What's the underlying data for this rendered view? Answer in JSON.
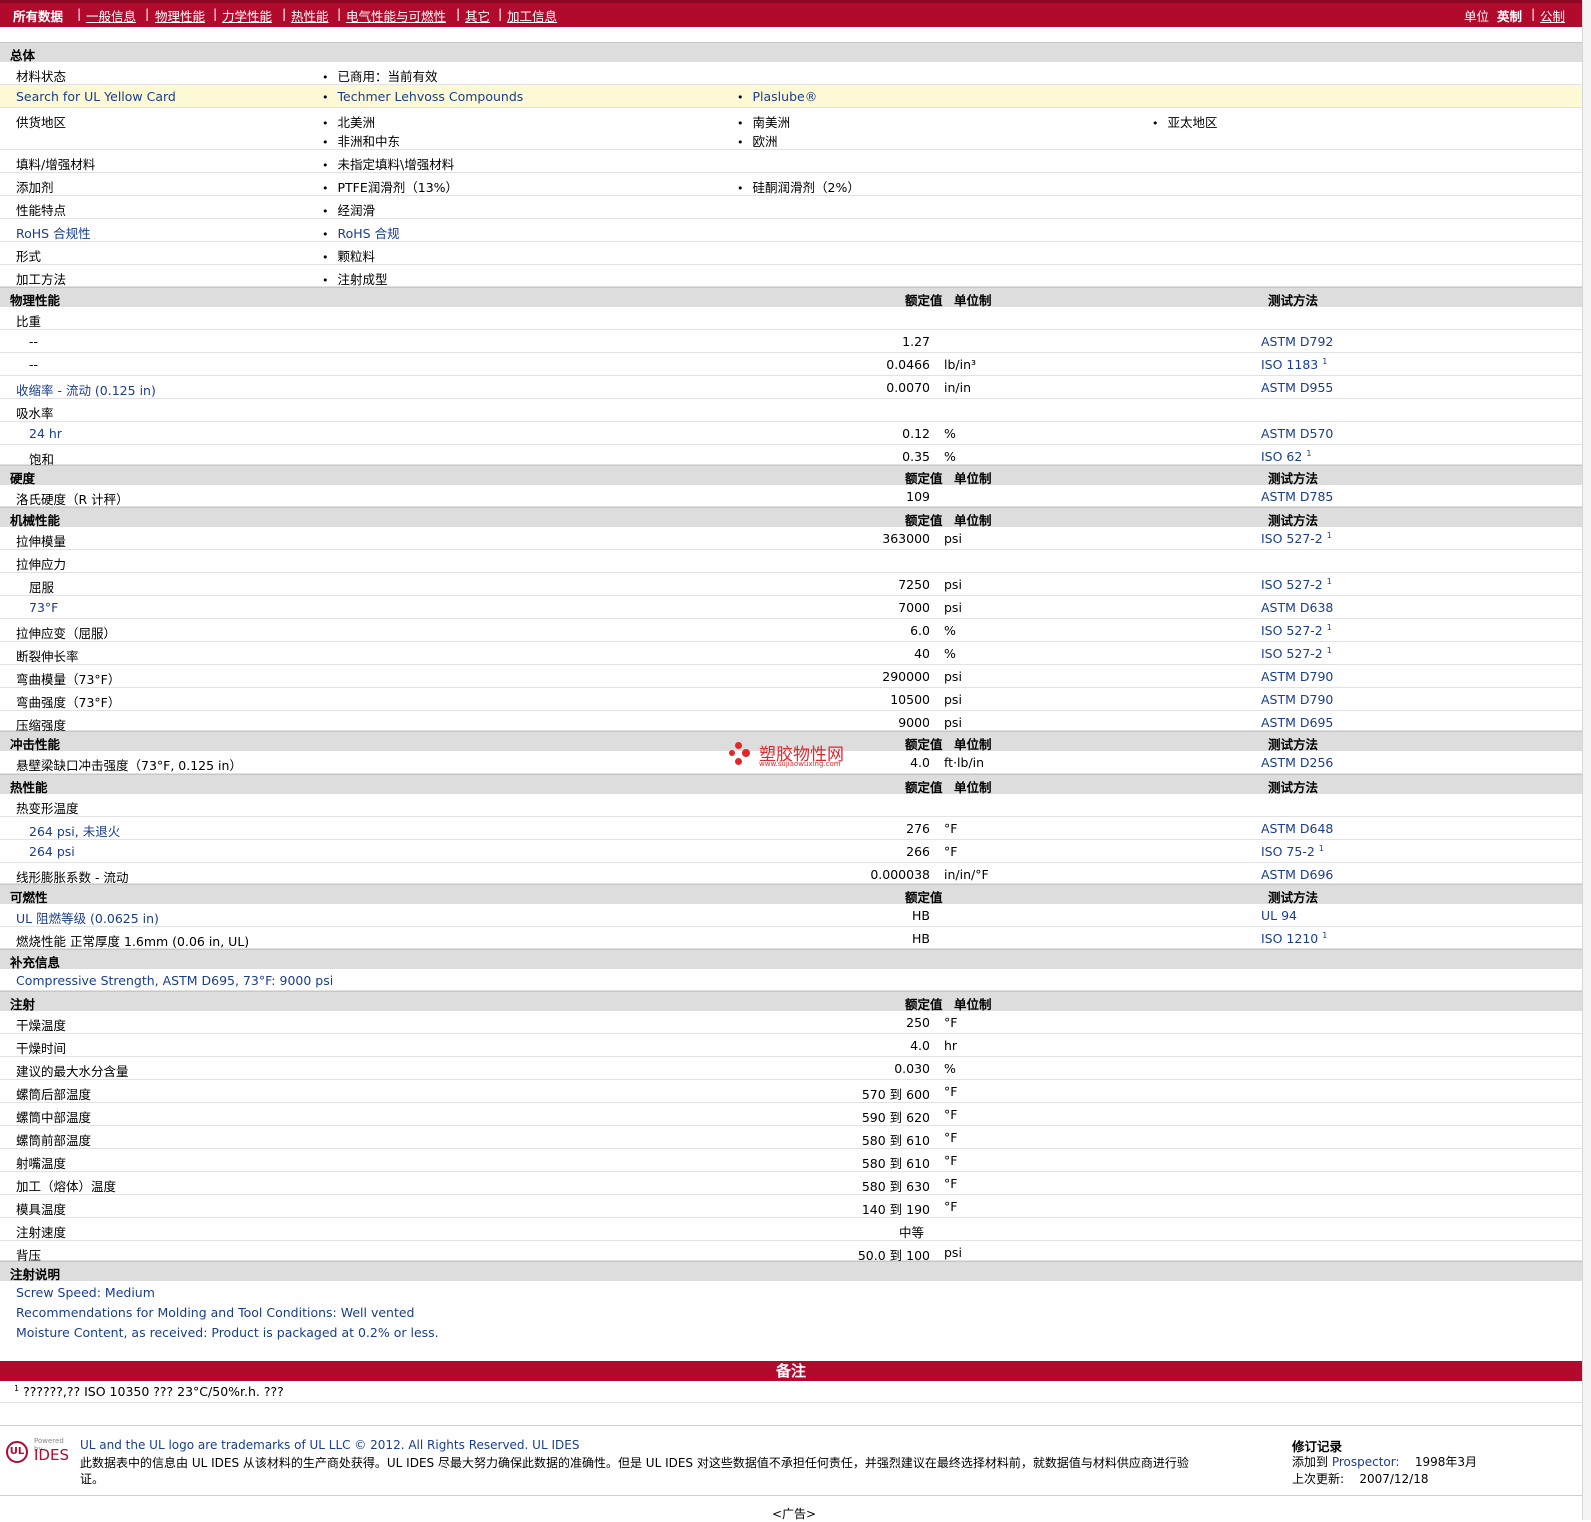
{
  "nav": {
    "all_data": "所有数据",
    "tabs": [
      "一般信息",
      "物理性能",
      "力学性能",
      "热性能",
      "电气性能与可燃性",
      "其它",
      "加工信息"
    ],
    "unit_label": "单位",
    "unit_imperial": "英制",
    "unit_metric": "公制"
  },
  "headers": {
    "nominal": "额定值",
    "unit": "单位制",
    "method": "测试方法"
  },
  "general": {
    "title": "总体",
    "rows": [
      {
        "label": "材料状态",
        "items": [
          "已商用：当前有效"
        ]
      },
      {
        "label": "Search for UL Yellow Card",
        "items": [
          "Techmer Lehvoss Compounds",
          "Plaslube®"
        ]
      },
      {
        "label": "供货地区",
        "items": [
          "北美洲",
          "南美洲",
          "亚太地区",
          "非洲和中东",
          "欧洲"
        ]
      },
      {
        "label": "填料/增强材料",
        "items": [
          "未指定填料\\增强材料"
        ]
      },
      {
        "label": "添加剂",
        "items": [
          "PTFE润滑剂（13%）",
          "硅酮润滑剂（2%）"
        ]
      },
      {
        "label": "性能特点",
        "items": [
          "经润滑"
        ]
      },
      {
        "label": "RoHS 合规性",
        "items": [
          "RoHS 合规"
        ]
      },
      {
        "label": "形式",
        "items": [
          "颗粒料"
        ]
      },
      {
        "label": "加工方法",
        "items": [
          "注射成型"
        ]
      }
    ]
  },
  "physical": {
    "title": "物理性能",
    "rows": [
      {
        "label": "比重",
        "value": "",
        "unit": "",
        "method": ""
      },
      {
        "label": "--",
        "value": "1.27",
        "unit": "",
        "method": "ASTM D792"
      },
      {
        "label": "--",
        "value": "0.0466",
        "unit": "lb/in³",
        "method": "ISO 1183"
      },
      {
        "label": "收缩率 - 流动 (0.125 in)",
        "value": "0.0070",
        "unit": "in/in",
        "method": "ASTM D955"
      },
      {
        "label": "吸水率",
        "value": "",
        "unit": "",
        "method": ""
      },
      {
        "label": "24 hr",
        "value": "0.12",
        "unit": "%",
        "method": "ASTM D570"
      },
      {
        "label": "饱和",
        "value": "0.35",
        "unit": "%",
        "method": "ISO 62"
      }
    ]
  },
  "hardness": {
    "title": "硬度",
    "rows": [
      {
        "label": "洛氏硬度（R 计秤）",
        "value": "109",
        "unit": "",
        "method": "ASTM D785"
      }
    ]
  },
  "mechanical": {
    "title": "机械性能",
    "rows": [
      {
        "label": "拉伸模量",
        "value": "363000",
        "unit": "psi",
        "method": "ISO 527-2"
      },
      {
        "label": "拉伸应力",
        "value": "",
        "unit": "",
        "method": ""
      },
      {
        "label": "屈服",
        "value": "7250",
        "unit": "psi",
        "method": "ISO 527-2"
      },
      {
        "label": "73°F",
        "value": "7000",
        "unit": "psi",
        "method": "ASTM D638"
      },
      {
        "label": "拉伸应变（屈服）",
        "value": "6.0",
        "unit": "%",
        "method": "ISO 527-2"
      },
      {
        "label": "断裂伸长率",
        "value": "40",
        "unit": "%",
        "method": "ISO 527-2"
      },
      {
        "label": "弯曲模量（73°F）",
        "value": "290000",
        "unit": "psi",
        "method": "ASTM D790"
      },
      {
        "label": "弯曲强度（73°F）",
        "value": "10500",
        "unit": "psi",
        "method": "ASTM D790"
      },
      {
        "label": "压缩强度",
        "value": "9000",
        "unit": "psi",
        "method": "ASTM D695"
      }
    ]
  },
  "impact": {
    "title": "冲击性能",
    "rows": [
      {
        "label": "悬壁梁缺口冲击强度（73°F, 0.125 in）",
        "value": "4.0",
        "unit": "ft·lb/in",
        "method": "ASTM D256"
      }
    ]
  },
  "thermal": {
    "title": "热性能",
    "rows": [
      {
        "label": "热变形温度",
        "value": "",
        "unit": "",
        "method": ""
      },
      {
        "label": "264 psi, 未退火",
        "value": "276",
        "unit": "°F",
        "method": "ASTM D648"
      },
      {
        "label": "264 psi",
        "value": "266",
        "unit": "°F",
        "method": "ISO 75-2"
      },
      {
        "label": "线形膨胀系数 - 流动",
        "value": "0.000038",
        "unit": "in/in/°F",
        "method": "ASTM D696"
      }
    ]
  },
  "flammability": {
    "title": "可燃性",
    "rows": [
      {
        "label": "UL 阻燃等级 (0.0625 in)",
        "value": "HB",
        "unit": "",
        "method": "UL 94"
      },
      {
        "label": "燃烧性能  正常厚度  1.6mm (0.06 in, UL)",
        "value": "HB",
        "unit": "",
        "method": "ISO 1210"
      }
    ]
  },
  "supplement": {
    "title": "补充信息",
    "text": "Compressive Strength, ASTM D695, 73°F: 9000 psi"
  },
  "injection": {
    "title": "注射",
    "rows": [
      {
        "label": "干燥温度",
        "value": "250",
        "unit": "°F"
      },
      {
        "label": "干燥时间",
        "value": "4.0",
        "unit": "hr"
      },
      {
        "label": "建议的最大水分含量",
        "value": "0.030",
        "unit": "%"
      },
      {
        "label": "螺筒后部温度",
        "value": "570 到  600",
        "unit": "°F"
      },
      {
        "label": "螺筒中部温度",
        "value": "590 到  620",
        "unit": "°F"
      },
      {
        "label": "螺筒前部温度",
        "value": "580 到  610",
        "unit": "°F"
      },
      {
        "label": "射嘴温度",
        "value": "580 到  610",
        "unit": "°F"
      },
      {
        "label": "加工（熔体）温度",
        "value": "580 到  630",
        "unit": "°F"
      },
      {
        "label": "模具温度",
        "value": "140 到  190",
        "unit": "°F"
      },
      {
        "label": "注射速度",
        "value": "中等",
        "unit": ""
      },
      {
        "label": "背压",
        "value": "50.0 到  100",
        "unit": "psi"
      }
    ]
  },
  "injection_notes": {
    "title": "注射说明",
    "lines": [
      "Screw Speed: Medium",
      "Recommendations for Molding and Tool Conditions: Well vented",
      "Moisture Content, as received: Product is packaged at 0.2% or less."
    ]
  },
  "notes": {
    "title": "备注",
    "footnote_mark": "1",
    "footnote": "??????,?? ISO 10350 ??? 23°C/50%r.h. ???"
  },
  "footer": {
    "powered_by": "Powered by",
    "logo_ul": "UL",
    "logo_ides": "IDES",
    "line1": "UL and the UL logo are trademarks of UL LLC © 2012. All Rights Reserved. UL IDES",
    "line2": "此数据表中的信息由  UL IDES 从该材料的生产商处获得。UL IDES 尽最大努力确保此数据的准确性。但是  UL IDES 对这些数据值不承担任何责任，并强烈建议在最终选择材料前，就数据值与材料供应商进行验",
    "line3": "证。",
    "rev_title": "修订记录",
    "added_label": "添加到",
    "added_to": "Prospector:",
    "added_date": "1998年3月",
    "updated_label": "上次更新:",
    "updated_date": "2007/12/18",
    "ad": "<广告>"
  },
  "watermark": {
    "title": "塑胶物性网",
    "url": "www.sujiaowuxing.com"
  }
}
